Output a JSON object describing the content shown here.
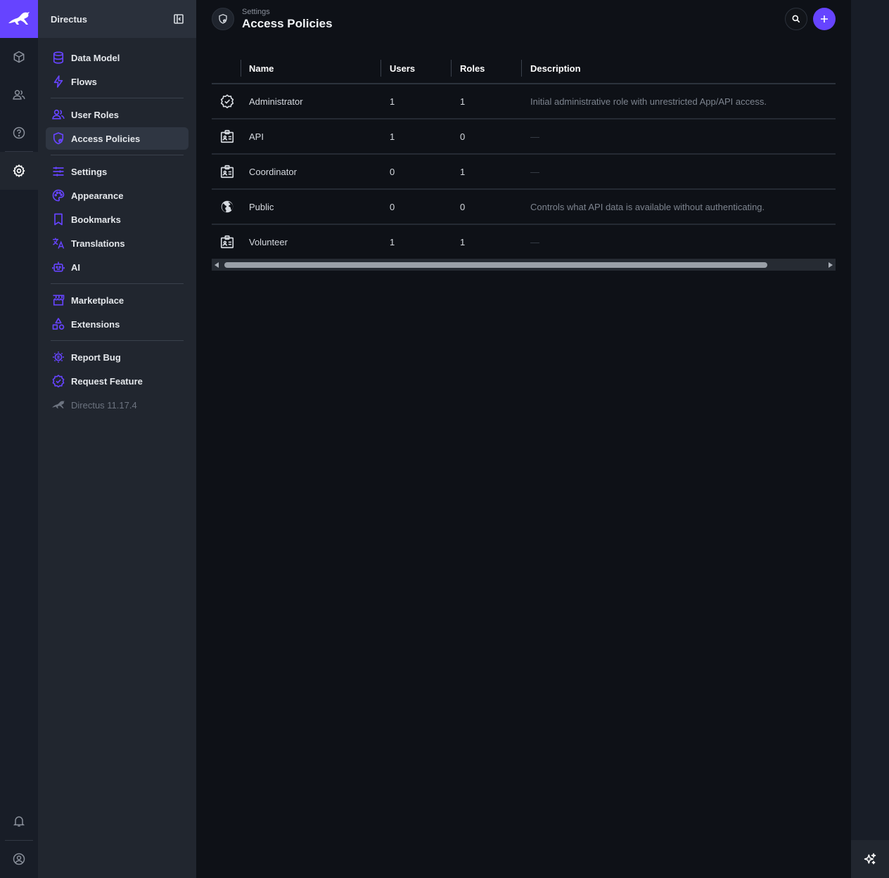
{
  "nav": {
    "title": "Directus",
    "groups": [
      [
        {
          "label": "Data Model",
          "icon": "database-icon"
        },
        {
          "label": "Flows",
          "icon": "bolt-icon"
        }
      ],
      [
        {
          "label": "User Roles",
          "icon": "users-icon"
        },
        {
          "label": "Access Policies",
          "icon": "policy-icon",
          "active": true
        }
      ],
      [
        {
          "label": "Settings",
          "icon": "sliders-icon"
        },
        {
          "label": "Appearance",
          "icon": "palette-icon"
        },
        {
          "label": "Bookmarks",
          "icon": "bookmark-icon"
        },
        {
          "label": "Translations",
          "icon": "translate-icon"
        },
        {
          "label": "AI",
          "icon": "robot-icon"
        }
      ],
      [
        {
          "label": "Marketplace",
          "icon": "store-icon"
        },
        {
          "label": "Extensions",
          "icon": "shapes-icon"
        }
      ],
      [
        {
          "label": "Report Bug",
          "icon": "bug-icon"
        },
        {
          "label": "Request Feature",
          "icon": "verified-icon"
        },
        {
          "label": "Directus 11.17.4",
          "icon": "directus-rabbit-icon",
          "muted": true
        }
      ]
    ]
  },
  "header": {
    "breadcrumb": "Settings",
    "title": "Access Policies"
  },
  "table": {
    "columns": [
      "Name",
      "Users",
      "Roles",
      "Description"
    ],
    "rows": [
      {
        "icon": "verified-icon",
        "name": "Administrator",
        "users": "1",
        "roles": "1",
        "description": "Initial administrative role with unrestricted App/API access."
      },
      {
        "icon": "badge-icon",
        "name": "API",
        "users": "1",
        "roles": "0",
        "description": "—"
      },
      {
        "icon": "badge-icon",
        "name": "Coordinator",
        "users": "0",
        "roles": "1",
        "description": "—"
      },
      {
        "icon": "public-icon",
        "name": "Public",
        "users": "0",
        "roles": "0",
        "description": "Controls what API data is available without authenticating."
      },
      {
        "icon": "badge-icon",
        "name": "Volunteer",
        "users": "1",
        "roles": "1",
        "description": "—"
      }
    ]
  },
  "colors": {
    "accent": "#6644ff",
    "background": "#0e1117",
    "nav_background": "#21262f",
    "module_bar": "#181d27"
  }
}
